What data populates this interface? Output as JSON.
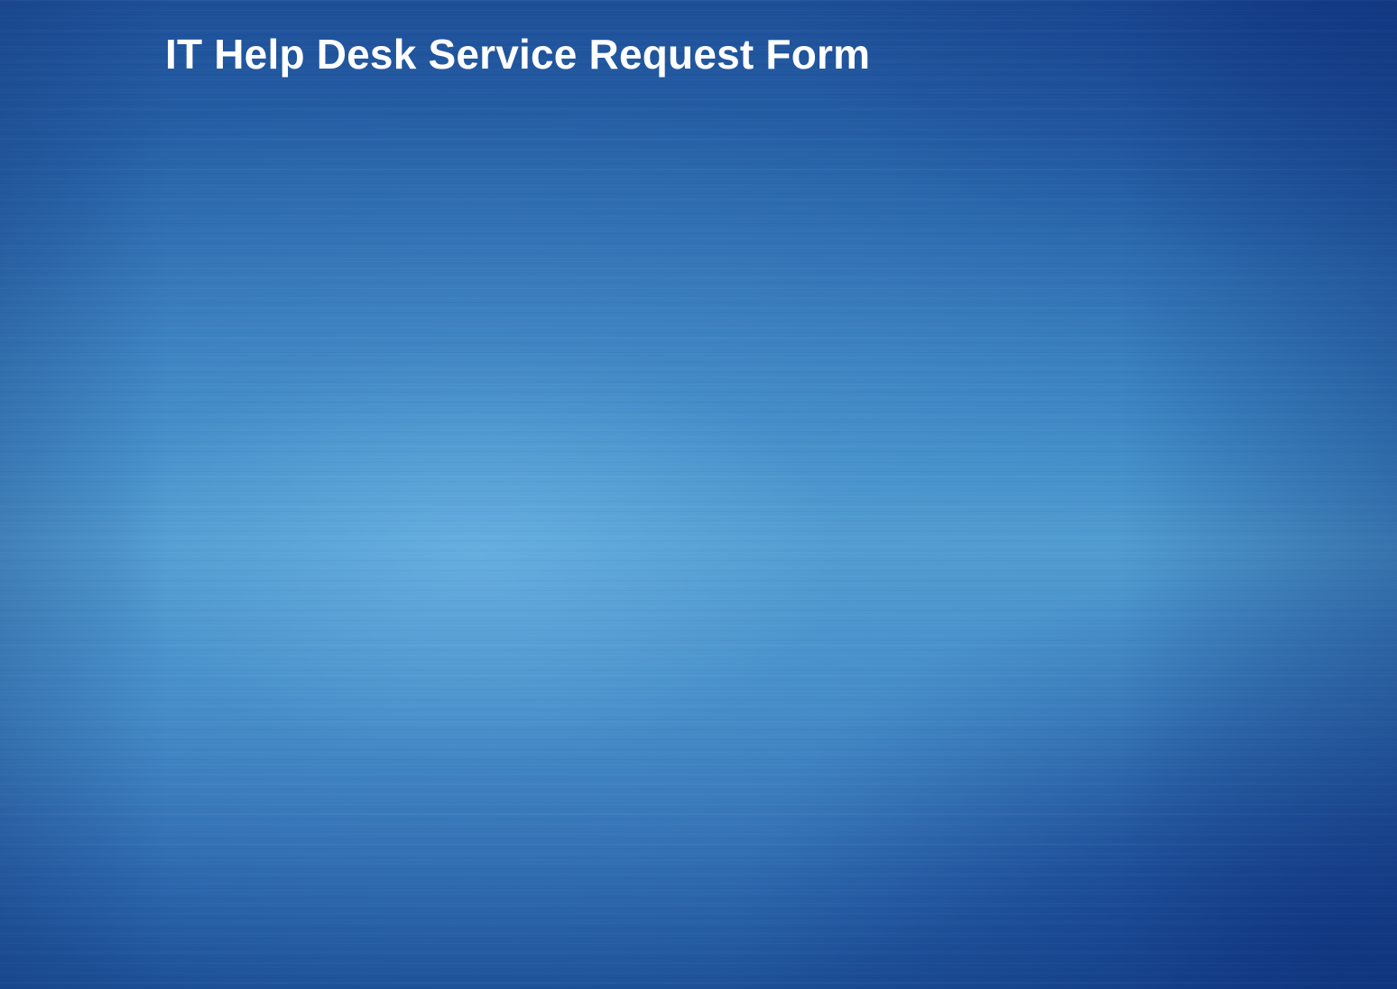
{
  "header": {
    "title": "IT Help Desk Service Request Form"
  },
  "colors": {
    "title_text": "#ffffff",
    "background_dark": "#1c4f96",
    "background_light": "#4f9bd0"
  }
}
